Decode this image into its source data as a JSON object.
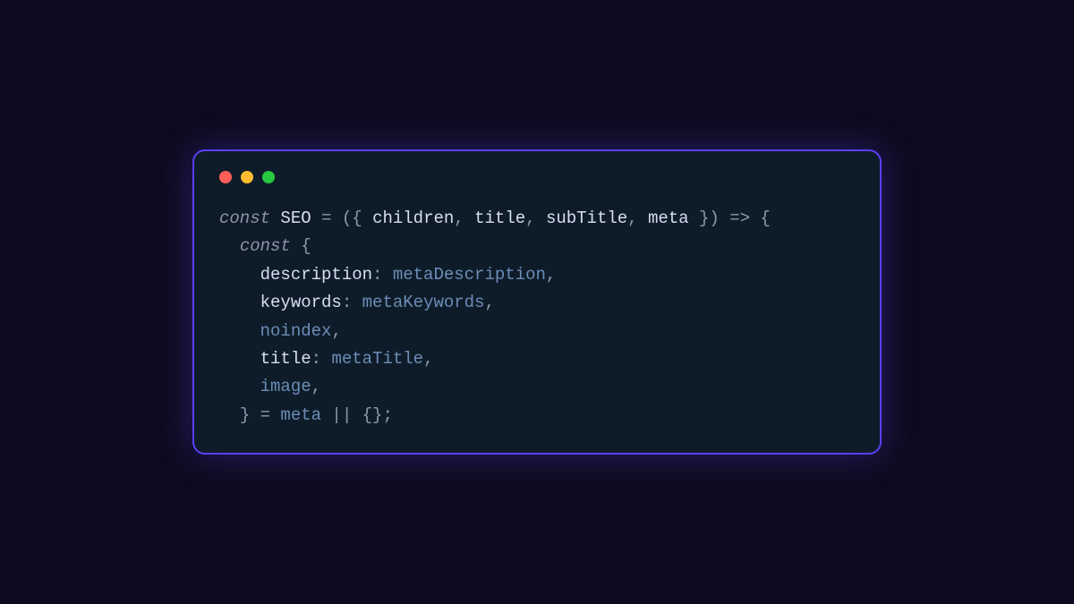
{
  "window": {
    "traffic_lights": [
      "close",
      "minimize",
      "zoom"
    ]
  },
  "code": {
    "line1": {
      "kw": "const",
      "fn": "SEO",
      "eq": " = ",
      "open": "({ ",
      "p1": "children",
      "c": ", ",
      "p2": "title",
      "p3": "subTitle",
      "p4": "meta",
      "close": " }) ",
      "arrow": "=>",
      "brace": " {"
    },
    "line2": {
      "indent": "  ",
      "kw": "const",
      "brace": " {"
    },
    "line3": {
      "indent": "    ",
      "key": "description",
      "colon": ": ",
      "val": "metaDescription",
      "comma": ","
    },
    "line4": {
      "indent": "    ",
      "key": "keywords",
      "colon": ": ",
      "val": "metaKeywords",
      "comma": ","
    },
    "line5": {
      "indent": "    ",
      "key": "noindex",
      "comma": ","
    },
    "line6": {
      "indent": "    ",
      "key": "title",
      "colon": ": ",
      "val": "metaTitle",
      "comma": ","
    },
    "line7": {
      "indent": "    ",
      "key": "image",
      "comma": ","
    },
    "line8": {
      "indent": "  ",
      "close": "} = ",
      "meta": "meta",
      "or": " || ",
      "empty": "{}",
      "semi": ";"
    }
  }
}
